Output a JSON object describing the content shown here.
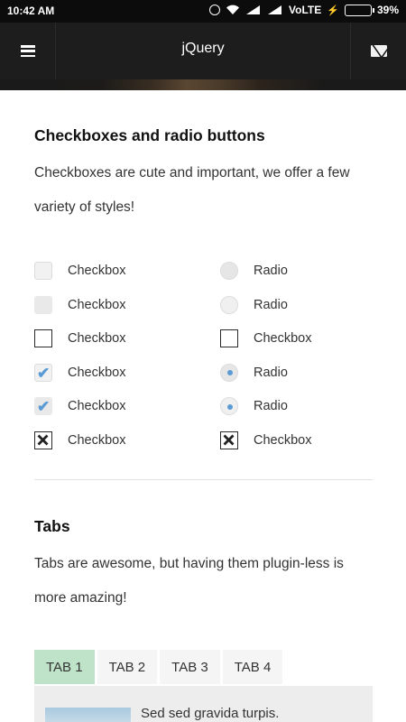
{
  "status_bar": {
    "time": "10:42 AM",
    "network": "VoLTE",
    "battery_percent": "39%",
    "battery_level": 0.39
  },
  "app_bar": {
    "title": "jQuery",
    "menu_icon": "hamburger-menu-icon",
    "mail_icon": "envelope-icon"
  },
  "checkbox_section": {
    "title": "Checkboxes and radio buttons",
    "description": "Checkboxes are cute and important, we offer a few variety of styles!",
    "rows": [
      {
        "left": {
          "kind": "checkbox-soft",
          "checked": false,
          "label": "Checkbox"
        },
        "right": {
          "kind": "radio-soft",
          "checked": false,
          "label": "Radio"
        }
      },
      {
        "left": {
          "kind": "checkbox-flat",
          "checked": false,
          "label": "Checkbox"
        },
        "right": {
          "kind": "radio-light",
          "checked": false,
          "label": "Radio"
        }
      },
      {
        "left": {
          "kind": "checkbox-outline",
          "checked": false,
          "label": "Checkbox"
        },
        "right": {
          "kind": "checkbox-outline",
          "checked": false,
          "label": "Checkbox"
        }
      },
      {
        "left": {
          "kind": "checkbox-soft",
          "checked": true,
          "label": "Checkbox"
        },
        "right": {
          "kind": "radio-soft",
          "checked": true,
          "label": "Radio"
        }
      },
      {
        "left": {
          "kind": "checkbox-flat",
          "checked": true,
          "label": "Checkbox"
        },
        "right": {
          "kind": "radio-light",
          "checked": true,
          "label": "Radio"
        }
      },
      {
        "left": {
          "kind": "checkbox-x",
          "checked": true,
          "label": "Checkbox"
        },
        "right": {
          "kind": "checkbox-x",
          "checked": true,
          "label": "Checkbox"
        }
      }
    ]
  },
  "tabs_section": {
    "title": "Tabs",
    "description": "Tabs are awesome, but having them plugin-less is more amazing!",
    "tabs": [
      {
        "label": "TAB 1",
        "active": true
      },
      {
        "label": "TAB 2",
        "active": false
      },
      {
        "label": "TAB 3",
        "active": false
      },
      {
        "label": "TAB 4",
        "active": false
      }
    ],
    "panel_text": "Sed sed gravida turpis."
  },
  "colors": {
    "accent_blue": "#5b9bd5",
    "active_tab": "#bfe3c8",
    "app_bar": "#1d1d1d"
  }
}
